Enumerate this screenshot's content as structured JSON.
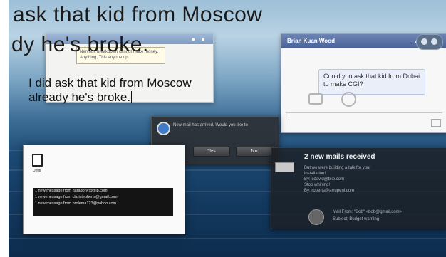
{
  "video_text": {
    "line1": "ask that kid from Moscow",
    "line2": "dy he's broke."
  },
  "note_window": {
    "tooltip": "Nervous breakdown cannot make money. Anything, This anyone op",
    "typed_line1": "I did ask that kid from Moscow",
    "typed_line2": "already he's broke."
  },
  "chat_window": {
    "title": "Brian Kuan Wood",
    "header_icons": "▴1",
    "message": "Could you ask that kid from Dubai to make CGI?"
  },
  "dialog": {
    "message": "New mail has arrived. Would you like to",
    "yes_label": "Yes",
    "no_label": "No"
  },
  "mail_notification": {
    "title": "2 new mails received",
    "body_lines": [
      "But we were building a talk for your",
      "installation!",
      "By: cdavid@blip.com",
      "Stop whining!",
      "By: roberts@arrupeni.com"
    ],
    "from_line1": "Mail From: \"Bob\" <bob@gmail.com>",
    "from_line2": "Subject: Budget warning"
  },
  "terminal_window": {
    "label": "Untitl",
    "log_lines": [
      "1 new message from haradony@blip.com",
      "1 new message from claristephens@gmail.com",
      "1 new message from prolema123@yahoo.com"
    ]
  },
  "colors": {
    "sea_top": "#9dbfd7",
    "sea_bottom": "#0d2c4d",
    "chat_header": "#5a71a7",
    "alert_red": "#b3222a"
  }
}
